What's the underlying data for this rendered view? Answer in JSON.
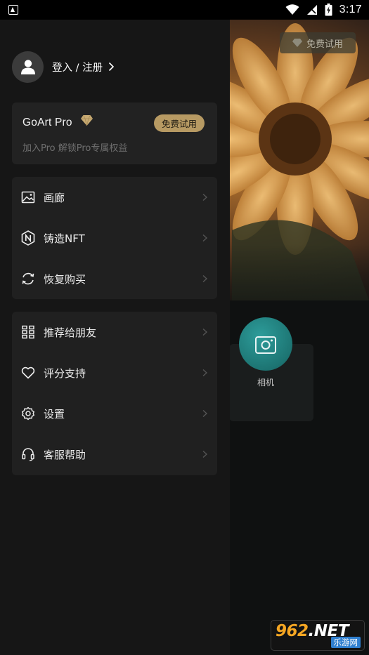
{
  "status_bar": {
    "time": "3:17",
    "icons": [
      "app-store-icon",
      "wifi-icon",
      "signal-icon",
      "battery-charging-icon"
    ]
  },
  "background": {
    "trial_button_label": "免费试用",
    "camera_label": "相机"
  },
  "drawer": {
    "login_label": "登入 / 注册",
    "pro_card": {
      "title": "GoArt Pro",
      "trial_label": "免费试用",
      "subtitle": "加入Pro 解锁Pro专属权益"
    },
    "group1": [
      {
        "label": "画廊",
        "icon": "gallery-icon"
      },
      {
        "label": "铸造NFT",
        "icon": "nft-icon"
      },
      {
        "label": "恢复购买",
        "icon": "restore-icon"
      }
    ],
    "group2": [
      {
        "label": "推荐给朋友",
        "icon": "recommend-icon"
      },
      {
        "label": "评分支持",
        "icon": "heart-icon"
      },
      {
        "label": "设置",
        "icon": "settings-icon"
      },
      {
        "label": "客服帮助",
        "icon": "headset-icon"
      }
    ]
  },
  "watermark": {
    "digits": "962",
    "net": ".NET",
    "bottom": "乐游网"
  },
  "colors": {
    "drawer_bg": "#161616",
    "card_bg": "#202020",
    "gold_accent": "#b79a63",
    "camera_teal": "#1d7573"
  }
}
